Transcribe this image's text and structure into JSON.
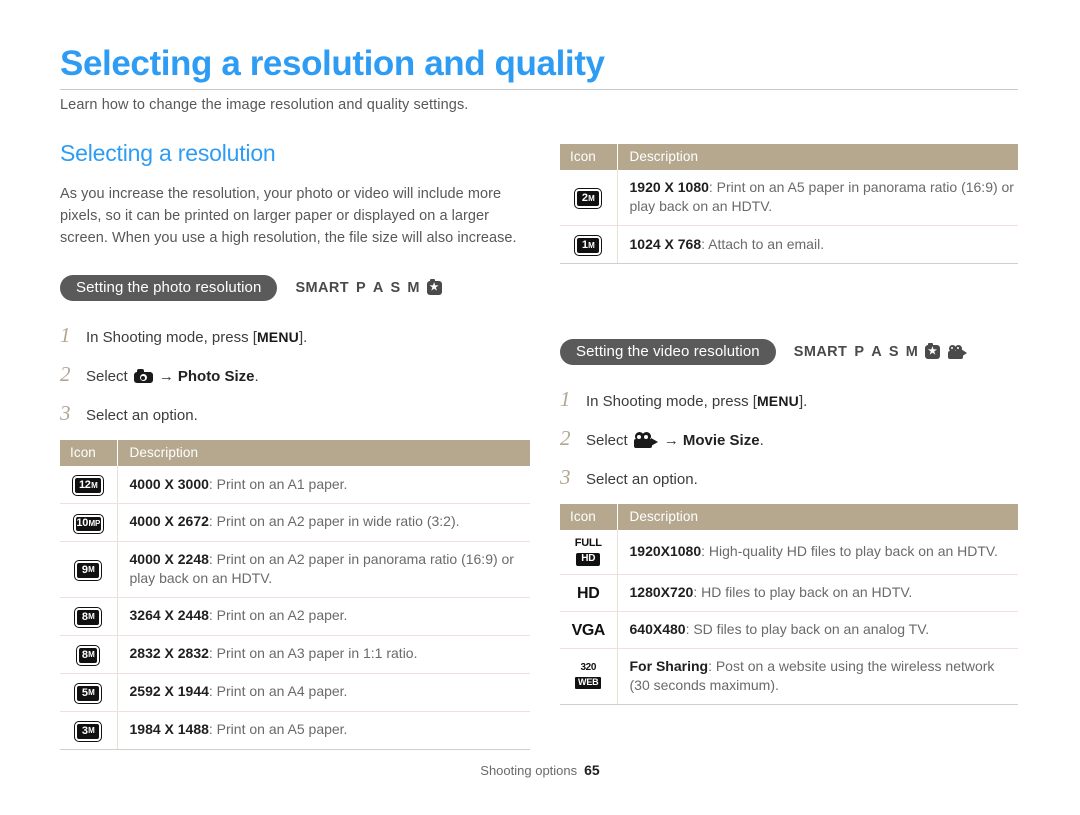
{
  "page": {
    "title": "Selecting a resolution and quality",
    "subtitle": "Learn how to change the image resolution and quality settings."
  },
  "footer": {
    "label": "Shooting options",
    "page_number": "65"
  },
  "section": {
    "heading": "Selecting a resolution",
    "body": "As you increase the resolution, your photo or video will include more pixels, so it can be printed on larger paper or displayed on a larger screen. When you use a high resolution, the file size will also increase."
  },
  "photo": {
    "pill_label": "Setting the photo resolution",
    "modes": [
      "SMART",
      "P",
      "A",
      "S",
      "M"
    ],
    "mode_icons": [
      "camera-star-icon"
    ],
    "steps": [
      {
        "num": "1",
        "prefix": "In Shooting mode, press [",
        "key": "MENU",
        "suffix": "]."
      },
      {
        "num": "2",
        "prefix": "Select ",
        "icon": "photo-camera-icon",
        "arrow": "→",
        "bold": "Photo Size",
        "suffix": "."
      },
      {
        "num": "3",
        "prefix": "Select an option."
      }
    ],
    "table": {
      "headers": [
        "Icon",
        "Description"
      ],
      "rows": [
        {
          "badge_num": "12",
          "badge_suf": "M",
          "badge_shape": "w-wide",
          "res": "4000 X 3000",
          "desc": ": Print on an A1 paper."
        },
        {
          "badge_num": "10",
          "badge_suf": "MP",
          "badge_shape": "w-med",
          "res": "4000 X 2672",
          "desc": ": Print on an A2 paper in wide ratio (3:2)."
        },
        {
          "badge_num": "9",
          "badge_suf": "M",
          "badge_shape": "w-narrow",
          "res": "4000 X 2248",
          "desc": ": Print on an A2 paper in panorama ratio (16:9) or play back on an HDTV."
        },
        {
          "badge_num": "8",
          "badge_suf": "M",
          "badge_shape": "w-narrow",
          "res": "3264 X 2448",
          "desc": ": Print on an A2 paper."
        },
        {
          "badge_num": "8",
          "badge_suf": "M",
          "badge_shape": "w-square",
          "res": "2832 X 2832",
          "desc": ": Print on an A3 paper in 1:1 ratio."
        },
        {
          "badge_num": "5",
          "badge_suf": "M",
          "badge_shape": "w-narrow",
          "res": "2592 X 1944",
          "desc": ": Print on an A4 paper."
        },
        {
          "badge_num": "3",
          "badge_suf": "M",
          "badge_shape": "w-narrow",
          "res": "1984 X 1488",
          "desc": ": Print on an A5 paper."
        }
      ]
    }
  },
  "photo_continued": {
    "table": {
      "headers": [
        "Icon",
        "Description"
      ],
      "rows": [
        {
          "badge_num": "2",
          "badge_suf": "M",
          "badge_shape": "w-narrow",
          "res": "1920 X 1080",
          "desc": ": Print on an A5 paper in panorama ratio (16:9) or play back on an HDTV."
        },
        {
          "badge_num": "1",
          "badge_suf": "M",
          "badge_shape": "w-narrow",
          "res": "1024 X 768",
          "desc": ": Attach to an email."
        }
      ]
    }
  },
  "video": {
    "pill_label": "Setting the video resolution",
    "modes": [
      "SMART",
      "P",
      "A",
      "S",
      "M"
    ],
    "mode_icons": [
      "camera-star-icon",
      "camcorder-icon"
    ],
    "steps": [
      {
        "num": "1",
        "prefix": "In Shooting mode, press [",
        "key": "MENU",
        "suffix": "]."
      },
      {
        "num": "2",
        "prefix": "Select ",
        "icon": "movie-camera-icon",
        "arrow": "→",
        "bold": "Movie Size",
        "suffix": "."
      },
      {
        "num": "3",
        "prefix": "Select an option."
      }
    ],
    "table": {
      "headers": [
        "Icon",
        "Description"
      ],
      "rows": [
        {
          "icon_kind": "fullhd",
          "icon_top": "FULL",
          "icon_bottom": "HD",
          "res": "1920X1080",
          "desc": ": High-quality HD files to play back on an HDTV."
        },
        {
          "icon_kind": "hd",
          "icon_text": "HD",
          "res": "1280X720",
          "desc": ": HD files to play back on an HDTV."
        },
        {
          "icon_kind": "vga",
          "icon_text": "VGA",
          "res": "640X480",
          "desc": ": SD files to play back on an analog TV."
        },
        {
          "icon_kind": "web",
          "icon_top": "320",
          "icon_bottom": "WEB",
          "res": "For Sharing",
          "desc": ": Post on a website using the wireless network (30 seconds maximum)."
        }
      ]
    }
  },
  "colors": {
    "accent_blue": "#2f9cf4",
    "table_header": "#b5a88f",
    "pill_gray": "#5a5a5a",
    "step_number": "#b3a695"
  }
}
